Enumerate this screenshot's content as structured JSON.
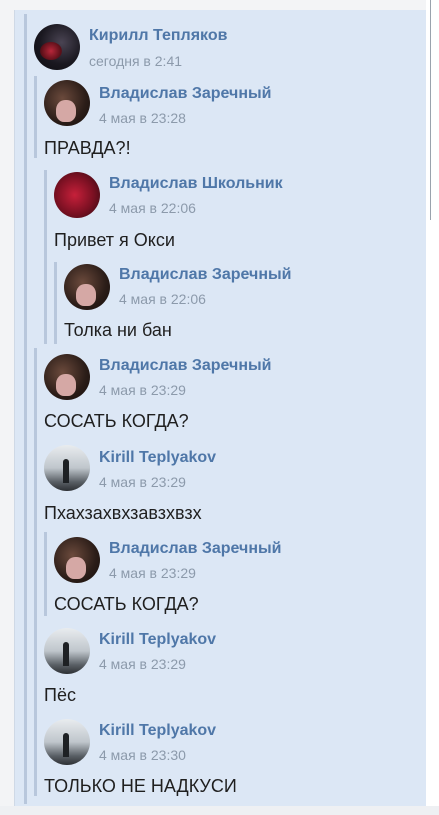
{
  "post": {
    "author": "Кирилл Тепляков",
    "time": "сегодня в 2:41"
  },
  "messages": [
    {
      "author": "Владислав Заречный",
      "time": "4 мая в 23:28",
      "text": "ПРАВДА?!"
    },
    {
      "author": "Владислав Школьник",
      "time": "4 мая в 22:06",
      "text": "Привет я Окси"
    },
    {
      "author": "Владислав Заречный",
      "time": "4 мая в 22:06",
      "text": "Толка ни бан"
    },
    {
      "author": "Владислав Заречный",
      "time": "4 мая в 23:29",
      "text": "СОСАТЬ КОГДА?"
    },
    {
      "author": "Kirill Teplyakov",
      "time": "4 мая в 23:29",
      "text": "Пхахзахвхзавзхвзх"
    },
    {
      "author": "Владислав Заречный",
      "time": "4 мая в 23:29",
      "text": "СОСАТЬ КОГДА?"
    },
    {
      "author": "Kirill Teplyakov",
      "time": "4 мая в 23:29",
      "text": "Пёс"
    },
    {
      "author": "Kirill Teplyakov",
      "time": "4 мая в 23:30",
      "text": "ТОЛЬКО НЕ НАДКУСИ"
    }
  ]
}
